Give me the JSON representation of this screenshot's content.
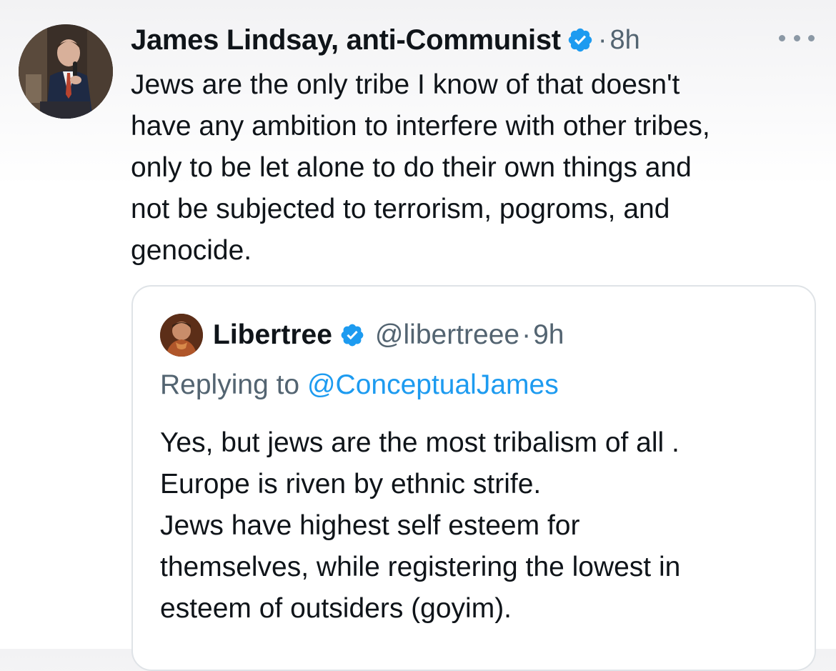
{
  "tweet": {
    "author_name": "James Lindsay, anti-Communist",
    "separator": "·",
    "time": "8h",
    "text": "Jews are the only tribe I know of that doesn't\nhave any ambition to interfere with other tribes,\nonly to be let alone to do their own things and\nnot be subjected to terrorism, pogroms, and\ngenocide."
  },
  "quoted": {
    "author_name": "Libertree",
    "handle": "@libertreee",
    "separator": "·",
    "time": "9h",
    "replying_label": "Replying to ",
    "replying_to": "@ConceptualJames",
    "text": "Yes, but jews are the most tribalism of all .\nEurope is riven by ethnic strife.\nJews have highest self esteem for\nthemselves, while registering the lowest in\nesteem of outsiders (goyim)."
  },
  "icons": {
    "verified": "verified-badge-icon",
    "more": "more-options-icon"
  },
  "colors": {
    "verified_blue": "#1d9bf0",
    "secondary_text": "#536471",
    "primary_text": "#0f1419",
    "border": "#dfe3e7"
  }
}
